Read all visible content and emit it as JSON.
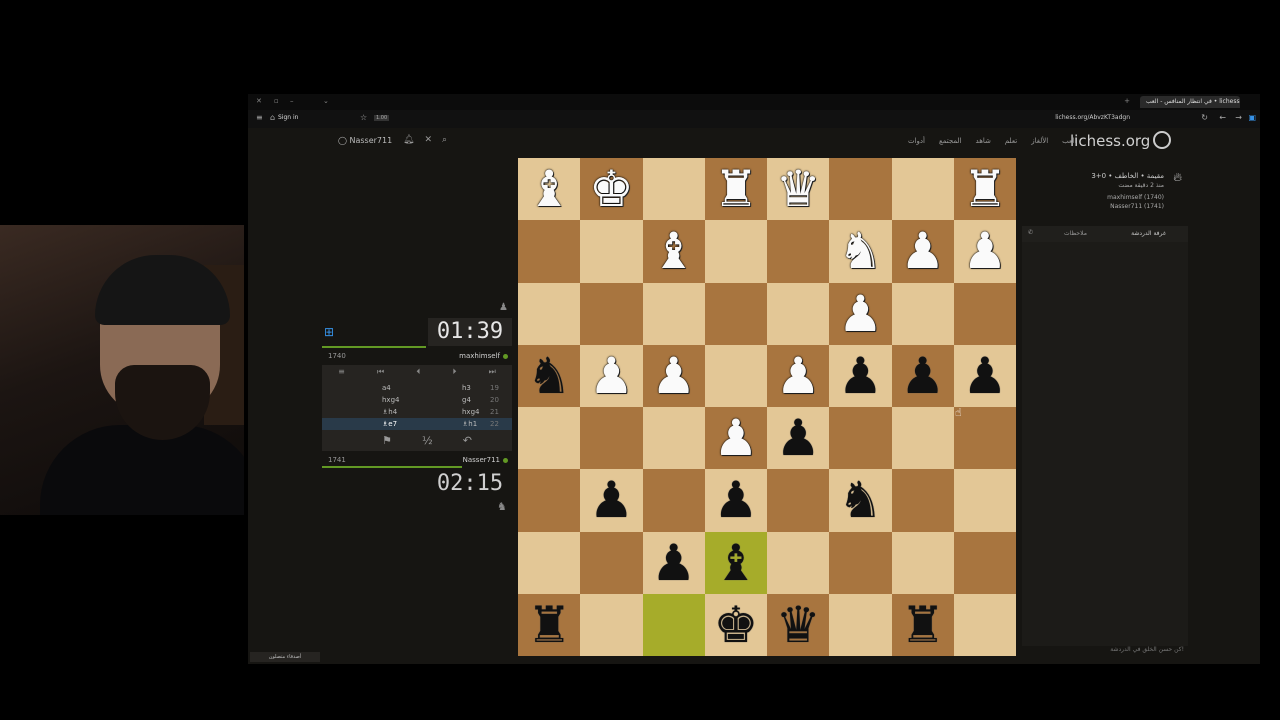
{
  "browser": {
    "tab_title": "في انتظار المنافس - العب • lichess.org",
    "url": "lichess.org/AbvzKT3adgn",
    "sign_in": "Sign in",
    "badge": "1.00"
  },
  "site": {
    "logo": "lichess.org",
    "nav": [
      "العب",
      "الألغاز",
      "تعلم",
      "شاهد",
      "المجتمع",
      "أدوات"
    ],
    "username": "Nasser711"
  },
  "game": {
    "type_line": "3+0 • مقيمة • الخاطف",
    "time_ago": "منذ 2 دقيقة مضت",
    "white_player": "maxhimself (1740)",
    "black_player": "Nasser711 (1741)"
  },
  "clocks": {
    "top": "01:39",
    "bottom": "02:15"
  },
  "players": {
    "top": {
      "name": "maxhimself",
      "rating": "1740"
    },
    "bottom": {
      "name": "Nasser711",
      "rating": "1741"
    }
  },
  "moves": [
    {
      "n": "19",
      "w": "h3",
      "b": "a4"
    },
    {
      "n": "20",
      "w": "g4",
      "b": "hxg4"
    },
    {
      "n": "21",
      "w": "hxg4",
      "b": "♗h4"
    },
    {
      "n": "22",
      "w": "♗h1",
      "b": "♗e7"
    }
  ],
  "panel": {
    "tab_chat": "غرفة الدردشة",
    "tab_notes": "ملاحظات",
    "chat_placeholder": "كن حسن الخلق في الدردشة!",
    "friends": "أصدقاء متصلون"
  },
  "board": [
    [
      "wB",
      "wK",
      "",
      "wR",
      "wQ",
      "",
      "",
      "wR"
    ],
    [
      "",
      "",
      "wB",
      "",
      "",
      "wN",
      "wP",
      "wP"
    ],
    [
      "",
      "",
      "",
      "",
      "",
      "wP",
      "",
      ""
    ],
    [
      "bN",
      "wP",
      "wP",
      "",
      "wP",
      "bP",
      "bP",
      "bP"
    ],
    [
      "",
      "",
      "",
      "wP",
      "bP",
      "",
      "",
      ""
    ],
    [
      "",
      "bP",
      "",
      "bP",
      "",
      "bN",
      "",
      ""
    ],
    [
      "",
      "",
      "bP",
      "bB",
      "",
      "",
      "",
      ""
    ],
    [
      "bR",
      "",
      "",
      "bK",
      "bQ",
      "",
      "bR",
      ""
    ]
  ],
  "highlights": [
    "6-3",
    "7-2"
  ],
  "colors": {
    "timebar": "#629924",
    "active_move": "#293a49"
  }
}
